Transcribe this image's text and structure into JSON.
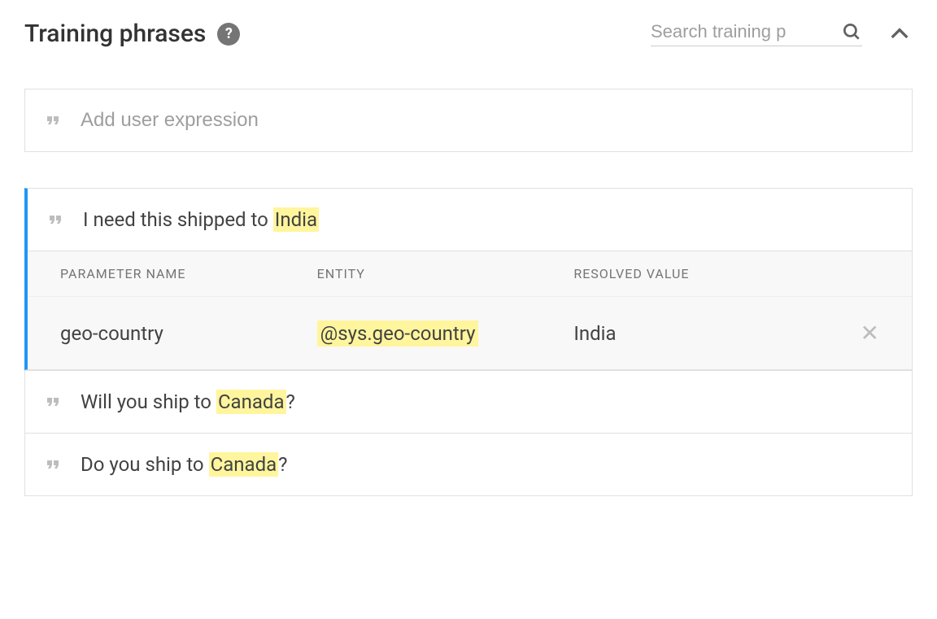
{
  "header": {
    "title": "Training phrases",
    "search_placeholder": "Search training p"
  },
  "add_row": {
    "placeholder": "Add user expression"
  },
  "selected_phrase": {
    "prefix": "I need this shipped to ",
    "highlight": "India",
    "suffix": ""
  },
  "param_table": {
    "headers": {
      "name": "PARAMETER NAME",
      "entity": "ENTITY",
      "value": "RESOLVED VALUE"
    },
    "row": {
      "name": "geo-country",
      "entity": "@sys.geo-country",
      "value": "India"
    }
  },
  "phrases": [
    {
      "prefix": "Will you ship to ",
      "highlight": "Canada",
      "suffix": "?"
    },
    {
      "prefix": "Do you ship to ",
      "highlight": "Canada",
      "suffix": "?"
    }
  ]
}
